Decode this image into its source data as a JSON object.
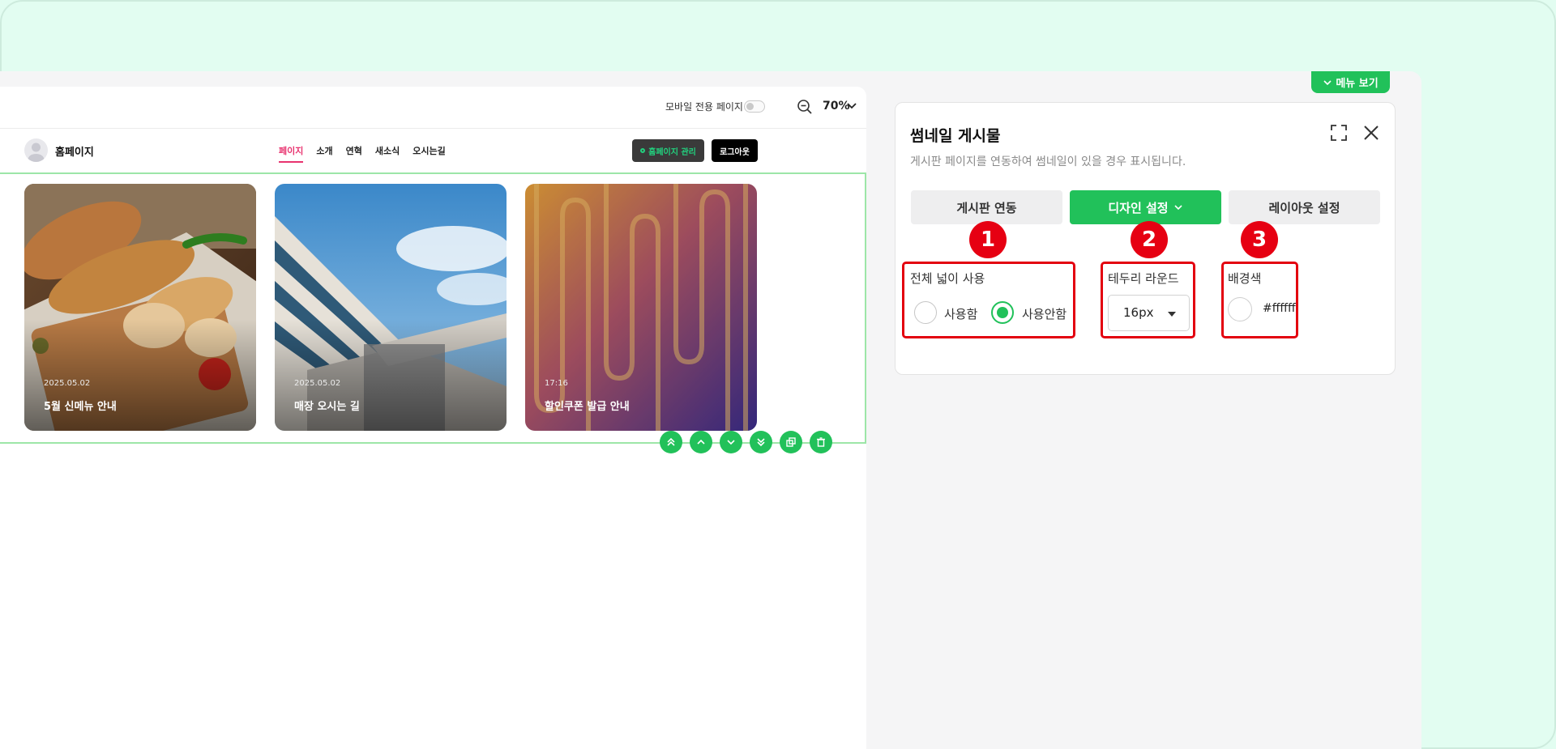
{
  "toolbar": {
    "mobile_label": "모바일 전용 페이지",
    "zoom": "70%"
  },
  "site": {
    "name": "홈페이지",
    "nav": [
      "페이지",
      "소개",
      "연혁",
      "새소식",
      "오시는길"
    ],
    "manage_button": "홈페이지 관리",
    "logout_button": "로그아웃"
  },
  "cards": [
    {
      "date": "2025.05.02",
      "title": "5월 신메뉴 안내"
    },
    {
      "date": "2025.05.02",
      "title": "매장 오시는 길"
    },
    {
      "date": "17:16",
      "title": "할인쿠폰 발급 안내"
    }
  ],
  "panel": {
    "menu_tab": "메뉴 보기",
    "title": "썸네일 게시물",
    "subtitle": "게시판 페이지를 연동하여 썸네일이 있을 경우 표시됩니다.",
    "tabs": [
      "게시판 연동",
      "디자인 설정",
      "레이아웃 설정"
    ],
    "badges": [
      "1",
      "2",
      "3"
    ],
    "full_width": {
      "label": "전체 넓이 사용",
      "options": [
        "사용함",
        "사용안함"
      ],
      "selected": "사용안함"
    },
    "border_radius": {
      "label": "테두리 라운드",
      "value": "16px"
    },
    "bg_color": {
      "label": "배경색",
      "value": "#ffffff"
    }
  },
  "colors": {
    "accent": "#21c15a",
    "highlight": "#e3000f",
    "active_nav": "#e8336f"
  }
}
